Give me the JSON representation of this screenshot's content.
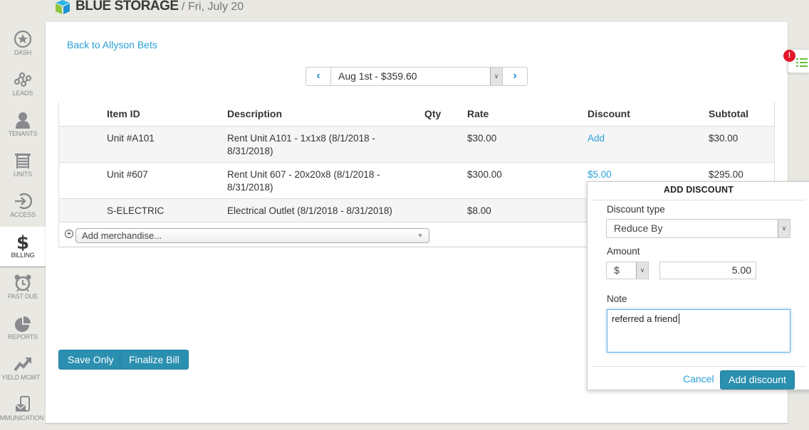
{
  "header": {
    "brand": "BLUE STORAGE",
    "date": " / Fri, July 20"
  },
  "sidebar": {
    "items": [
      {
        "label": "DASH",
        "icon": "star-icon"
      },
      {
        "label": "LEADS",
        "icon": "network-icon"
      },
      {
        "label": "TENANTS",
        "icon": "person-icon"
      },
      {
        "label": "UNITS",
        "icon": "garage-icon"
      },
      {
        "label": "ACCESS",
        "icon": "enter-icon"
      },
      {
        "label": "BILLING",
        "icon": "dollar-icon",
        "active": true
      },
      {
        "label": "PAST DUE",
        "icon": "alarm-clock-icon"
      },
      {
        "label": "REPORTS",
        "icon": "pie-chart-icon"
      },
      {
        "label": "YIELD MGMT",
        "icon": "trending-up-icon"
      },
      {
        "label": "COMMUNICATION",
        "icon": "mail-phone-icon"
      }
    ]
  },
  "main": {
    "back_link": "Back to Allyson Bets",
    "bill_selector": {
      "selected": "Aug 1st - $359.60"
    },
    "table": {
      "headers": [
        "Item ID",
        "Description",
        "Qty",
        "Rate",
        "Discount",
        "Subtotal"
      ],
      "rows": [
        {
          "item_id": "Unit #A101",
          "description": "Rent Unit A101 - 1x1x8 (8/1/2018 - 8/31/2018)",
          "qty": "",
          "rate": "$30.00",
          "discount": "Add",
          "subtotal": "$30.00"
        },
        {
          "item_id": "Unit #607",
          "description": "Rent Unit 607 - 20x20x8 (8/1/2018 - 8/31/2018)",
          "qty": "",
          "rate": "$300.00",
          "discount": "$5.00",
          "subtotal": "$295.00"
        },
        {
          "item_id": "S-ELECTRIC",
          "description": "Electrical Outlet (8/1/2018 - 8/31/2018)",
          "qty": "",
          "rate": "$8.00",
          "discount": "",
          "subtotal": ""
        }
      ],
      "add_merchandise_placeholder": "Add merchandise..."
    },
    "buttons": {
      "save_only": "Save Only",
      "finalize_bill": "Finalize Bill"
    }
  },
  "alert_badge": "!",
  "popover": {
    "title": "ADD DISCOUNT",
    "discount_type_label": "Discount type",
    "discount_type_value": "Reduce By",
    "amount_label": "Amount",
    "amount_unit": "$",
    "amount_value": "5.00",
    "note_label": "Note",
    "note_value": "referred a friend",
    "cancel": "Cancel",
    "submit": "Add discount"
  },
  "colors": {
    "accent": "#2b8fb0",
    "link": "#2ba0d8",
    "alert": "#e3172a"
  }
}
